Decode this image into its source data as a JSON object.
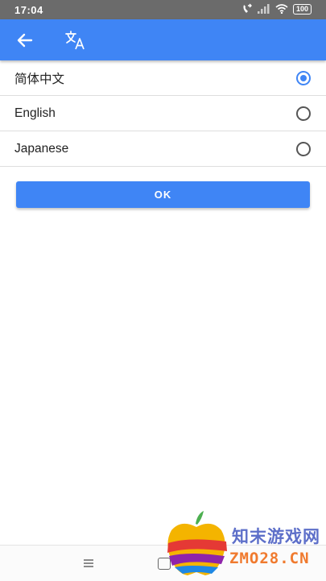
{
  "status_bar": {
    "time": "17:04",
    "battery": "100",
    "icons": [
      "call-forward-icon",
      "signal-icon",
      "wifi-icon",
      "battery-icon"
    ]
  },
  "app_bar": {
    "color": "#3f85f5",
    "back_icon": "arrow-left-icon",
    "title_icon": "translate-icon"
  },
  "languages": [
    {
      "label": "简体中文",
      "selected": true
    },
    {
      "label": "English",
      "selected": false
    },
    {
      "label": "Japanese",
      "selected": false
    }
  ],
  "ok_button": {
    "label": "OK"
  },
  "nav_bar": {
    "icons": [
      "menu-icon",
      "home-icon"
    ]
  },
  "watermark": {
    "title": "知末游戏网",
    "domain": "ZMO28.CN"
  }
}
